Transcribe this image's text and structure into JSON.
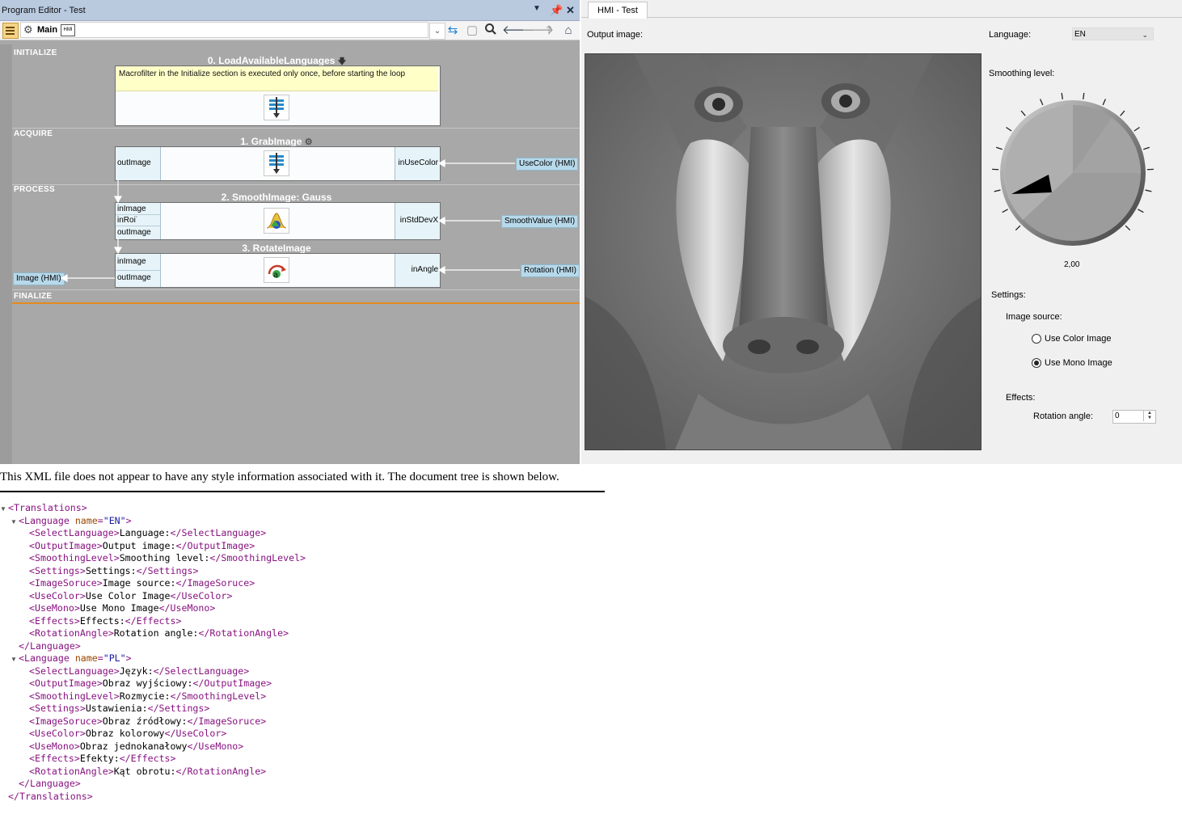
{
  "editor": {
    "title": "Program Editor - Test",
    "tab_label": "Main",
    "tab_badge": "HMI",
    "sections": {
      "initialize": "INITIALIZE",
      "acquire": "ACQUIRE",
      "process": "PROCESS",
      "finalize": "FINALIZE"
    },
    "filters": [
      {
        "title": "0. LoadAvailableLanguages",
        "note": "Macrofilter in the Initialize section is executed only once, before starting the loop"
      },
      {
        "title": "1. GrabImage",
        "inputs": [],
        "outputs": [
          "outImage"
        ],
        "right_port": "inUseColor",
        "hmi": "UseColor (HMI)"
      },
      {
        "title": "2. SmoothImage: Gauss",
        "inputs": [
          "inImage",
          "inRoi˙"
        ],
        "outputs": [
          "outImage"
        ],
        "right_port": "inStdDevX",
        "hmi": "SmoothValue (HMI)"
      },
      {
        "title": "3. RotateImage",
        "inputs": [
          "inImage"
        ],
        "outputs": [
          "outImage"
        ],
        "right_port": "inAngle",
        "hmi": "Rotation (HMI)",
        "out_hmi": "Image (HMI)"
      }
    ]
  },
  "hmi": {
    "tab_title": "HMI - Test",
    "output_image_label": "Output image:",
    "language_label": "Language:",
    "language_value": "EN",
    "smoothing_label": "Smoothing level:",
    "smoothing_value": "2,00",
    "settings_label": "Settings:",
    "image_source_label": "Image source:",
    "radio_color": "Use Color Image",
    "radio_mono": "Use Mono Image",
    "selected_source": "mono",
    "effects_label": "Effects:",
    "rotation_label": "Rotation angle:",
    "rotation_value": "0"
  },
  "xml": {
    "banner": "This XML file does not appear to have any style information associated with it. The document tree is shown below.",
    "root": "Translations",
    "languages": [
      {
        "name": "EN",
        "entries": [
          {
            "tag": "SelectLanguage",
            "text": "Language:"
          },
          {
            "tag": "OutputImage",
            "text": "Output image:"
          },
          {
            "tag": "SmoothingLevel",
            "text": "Smoothing level:"
          },
          {
            "tag": "Settings",
            "text": "Settings:"
          },
          {
            "tag": "ImageSoruce",
            "text": "Image source:"
          },
          {
            "tag": "UseColor",
            "text": "Use Color Image"
          },
          {
            "tag": "UseMono",
            "text": "Use Mono Image"
          },
          {
            "tag": "Effects",
            "text": "Effects:"
          },
          {
            "tag": "RotationAngle",
            "text": "Rotation angle:"
          }
        ]
      },
      {
        "name": "PL",
        "entries": [
          {
            "tag": "SelectLanguage",
            "text": "Język:"
          },
          {
            "tag": "OutputImage",
            "text": "Obraz wyjściowy:"
          },
          {
            "tag": "SmoothingLevel",
            "text": "Rozmycie:"
          },
          {
            "tag": "Settings",
            "text": "Ustawienia:"
          },
          {
            "tag": "ImageSoruce",
            "text": "Obraz źródłowy:"
          },
          {
            "tag": "UseColor",
            "text": "Obraz kolorowy"
          },
          {
            "tag": "UseMono",
            "text": "Obraz jednokanałowy"
          },
          {
            "tag": "Effects",
            "text": "Efekty:"
          },
          {
            "tag": "RotationAngle",
            "text": "Kąt obrotu:"
          }
        ]
      }
    ]
  },
  "colors": {
    "editor_bg": "#a8a8a8",
    "port_bg": "#e6f3f8",
    "hmi_tag_bg": "#b7d9ea",
    "finalize_line": "#e58a1f",
    "xml_tag": "#881280",
    "xml_attr_name": "#994500",
    "xml_attr_value": "#1a1aa6"
  },
  "icons": [
    "menu-icon",
    "gear-icon",
    "hmi-badge-icon",
    "chevron-down-icon",
    "swap-icon",
    "page-icon",
    "search-icon",
    "arrow-left-icon",
    "arrow-right-icon",
    "arrow-up-icon",
    "home-icon",
    "dropdown-arrow-icon",
    "pin-icon",
    "close-icon",
    "macrofilter-icon",
    "smooth-icon",
    "rotate-icon",
    "knob-icon"
  ]
}
